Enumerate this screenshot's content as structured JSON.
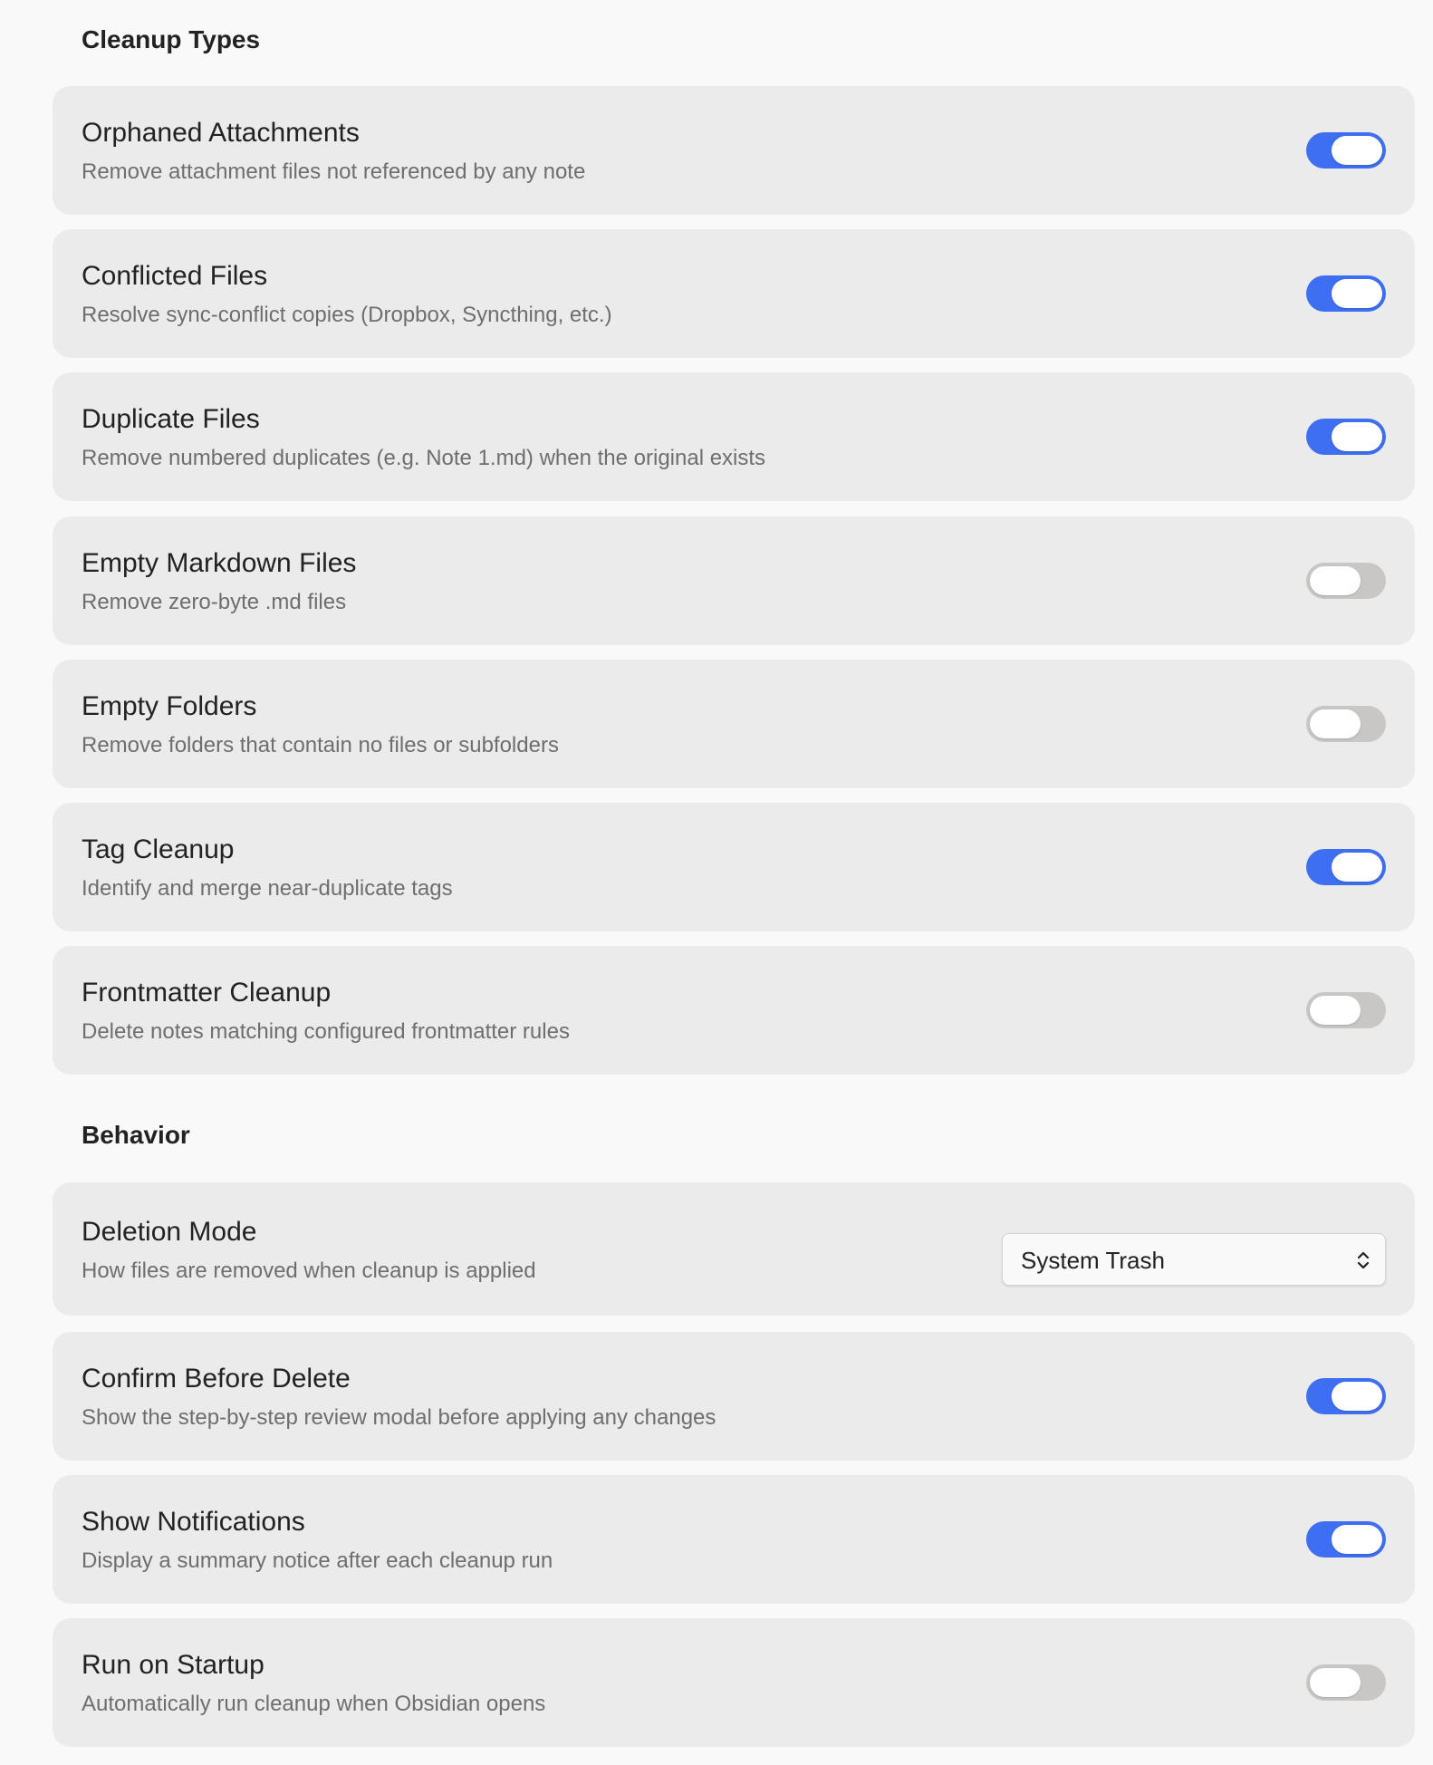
{
  "sections": {
    "cleanup_types": {
      "heading": "Cleanup Types",
      "items": [
        {
          "title": "Orphaned Attachments",
          "description": "Remove attachment files not referenced by any note",
          "enabled": true
        },
        {
          "title": "Conflicted Files",
          "description": "Resolve sync-conflict copies (Dropbox, Syncthing, etc.)",
          "enabled": true
        },
        {
          "title": "Duplicate Files",
          "description": "Remove numbered duplicates (e.g. Note 1.md) when the original exists",
          "enabled": true
        },
        {
          "title": "Empty Markdown Files",
          "description": "Remove zero-byte .md files",
          "enabled": false
        },
        {
          "title": "Empty Folders",
          "description": "Remove folders that contain no files or subfolders",
          "enabled": false
        },
        {
          "title": "Tag Cleanup",
          "description": "Identify and merge near-duplicate tags",
          "enabled": true
        },
        {
          "title": "Frontmatter Cleanup",
          "description": "Delete notes matching configured frontmatter rules",
          "enabled": false
        }
      ]
    },
    "behavior": {
      "heading": "Behavior",
      "deletion_mode": {
        "title": "Deletion Mode",
        "description": "How files are removed when cleanup is applied",
        "selected": "System Trash"
      },
      "items": [
        {
          "title": "Confirm Before Delete",
          "description": "Show the step-by-step review modal before applying any changes",
          "enabled": true
        },
        {
          "title": "Show Notifications",
          "description": "Display a summary notice after each cleanup run",
          "enabled": true
        },
        {
          "title": "Run on Startup",
          "description": "Automatically run cleanup when Obsidian opens",
          "enabled": false
        }
      ]
    }
  },
  "colors": {
    "toggle_on": "#3e6ff2",
    "toggle_off": "#c9c7c5",
    "card_background": "#ebebeb",
    "page_background": "#f9f9f9"
  }
}
